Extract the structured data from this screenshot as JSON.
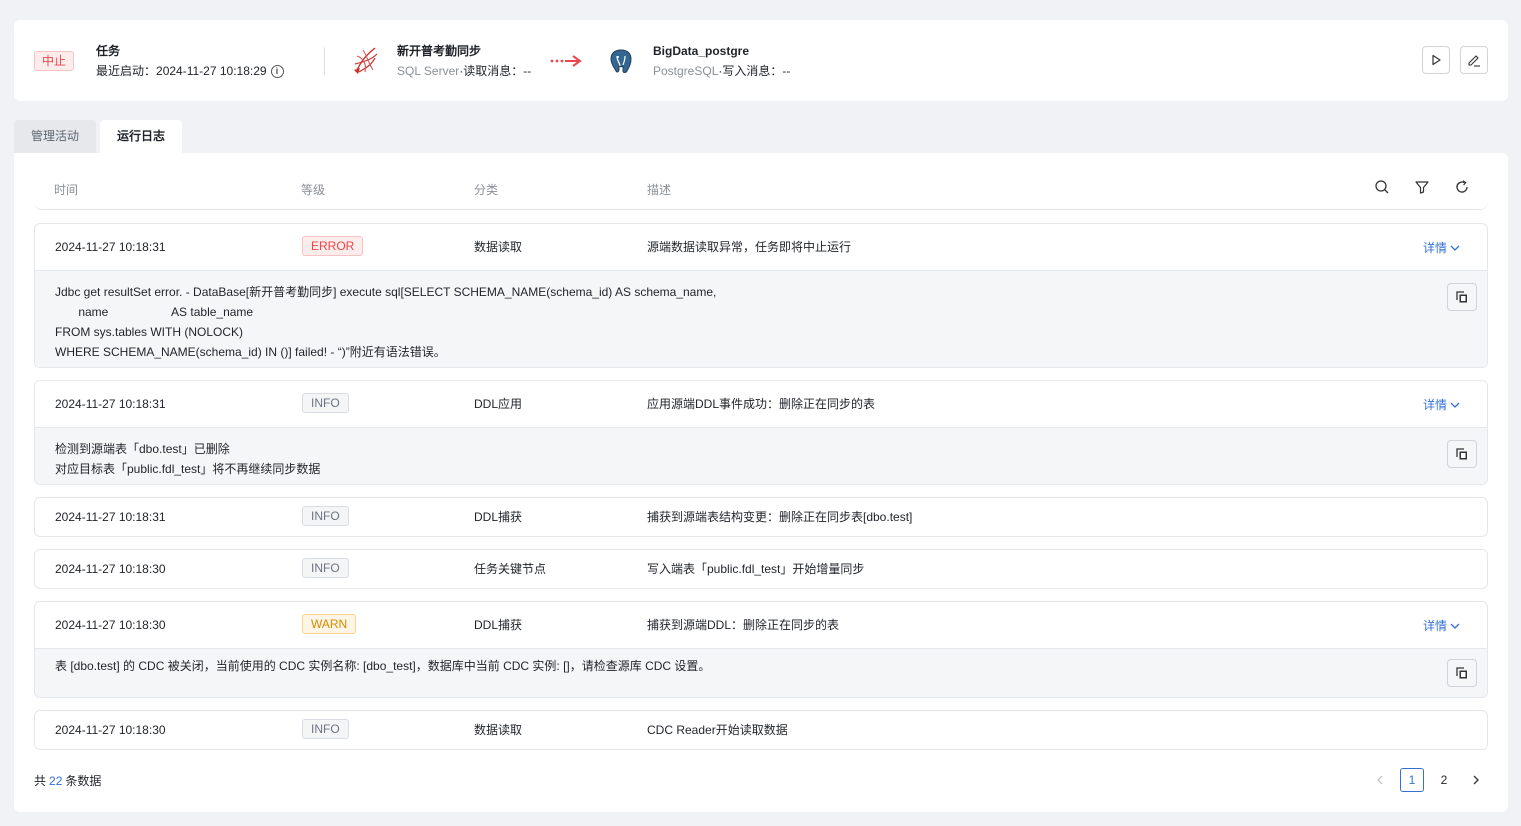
{
  "header": {
    "status": "中止",
    "task_title": "任务",
    "last_start_label": "最近启动：",
    "last_start_time": "2024-11-27 10:18:29",
    "source": {
      "name": "新开普考勤同步",
      "type": "SQL Server",
      "msg_label": "·读取消息：",
      "msg_value": "--"
    },
    "target": {
      "name": "BigData_postgre",
      "type": "PostgreSQL",
      "msg_label": "·写入消息：",
      "msg_value": "--"
    },
    "icons": {
      "source": "sqlserver-icon",
      "target": "postgresql-icon",
      "arrow": "sync-arrow-icon",
      "run": "play-icon",
      "edit": "edit-icon",
      "info": "info-icon"
    },
    "colors": {
      "stopped": "#e5484d",
      "arrow": "#e5484d"
    }
  },
  "tabs": [
    {
      "label": "管理活动",
      "active": false
    },
    {
      "label": "运行日志",
      "active": true
    }
  ],
  "table": {
    "columns": [
      "时间",
      "等级",
      "分类",
      "描述"
    ],
    "tool_icons": [
      "search-icon",
      "filter-icon",
      "refresh-icon"
    ],
    "detail_label": "详情"
  },
  "logs": [
    {
      "time": "2024-11-27 10:18:31",
      "level": "ERROR",
      "category": "数据读取",
      "desc": "源端数据读取异常，任务即将中止运行",
      "expanded": true,
      "detail": [
        "Jdbc get resultSet error. - DataBase[新开普考勤同步] execute sql[SELECT SCHEMA_NAME(schema_id) AS schema_name,",
        "       name                   AS table_name",
        "FROM sys.tables WITH (NOLOCK)",
        "WHERE SCHEMA_NAME(schema_id) IN ()] failed! - “)”附近有语法错误。"
      ]
    },
    {
      "time": "2024-11-27 10:18:31",
      "level": "INFO",
      "category": "DDL应用",
      "desc": "应用源端DDL事件成功：删除正在同步的表",
      "expanded": true,
      "detail": [
        "检测到源端表「dbo.test」已删除",
        "对应目标表「public.fdl_test」将不再继续同步数据"
      ]
    },
    {
      "time": "2024-11-27 10:18:31",
      "level": "INFO",
      "category": "DDL捕获",
      "desc": "捕获到源端表结构变更：删除正在同步表[dbo.test]",
      "expanded": false
    },
    {
      "time": "2024-11-27 10:18:30",
      "level": "INFO",
      "category": "任务关键节点",
      "desc": "写入端表「public.fdl_test」开始增量同步",
      "expanded": false
    },
    {
      "time": "2024-11-27 10:18:30",
      "level": "WARN",
      "category": "DDL捕获",
      "desc": "捕获到源端DDL：删除正在同步的表",
      "expanded": true,
      "detail": [
        "表 [dbo.test] 的 CDC 被关闭，当前使用的 CDC 实例名称: [dbo_test]，数据库中当前 CDC 实例: []，请检查源库 CDC 设置。"
      ]
    },
    {
      "time": "2024-11-27 10:18:30",
      "level": "INFO",
      "category": "数据读取",
      "desc": "CDC Reader开始读取数据",
      "expanded": false
    }
  ],
  "footer": {
    "total_prefix": "共",
    "total": "22",
    "total_suffix": "条数据",
    "pages": [
      "1",
      "2"
    ],
    "current_page": "1"
  }
}
